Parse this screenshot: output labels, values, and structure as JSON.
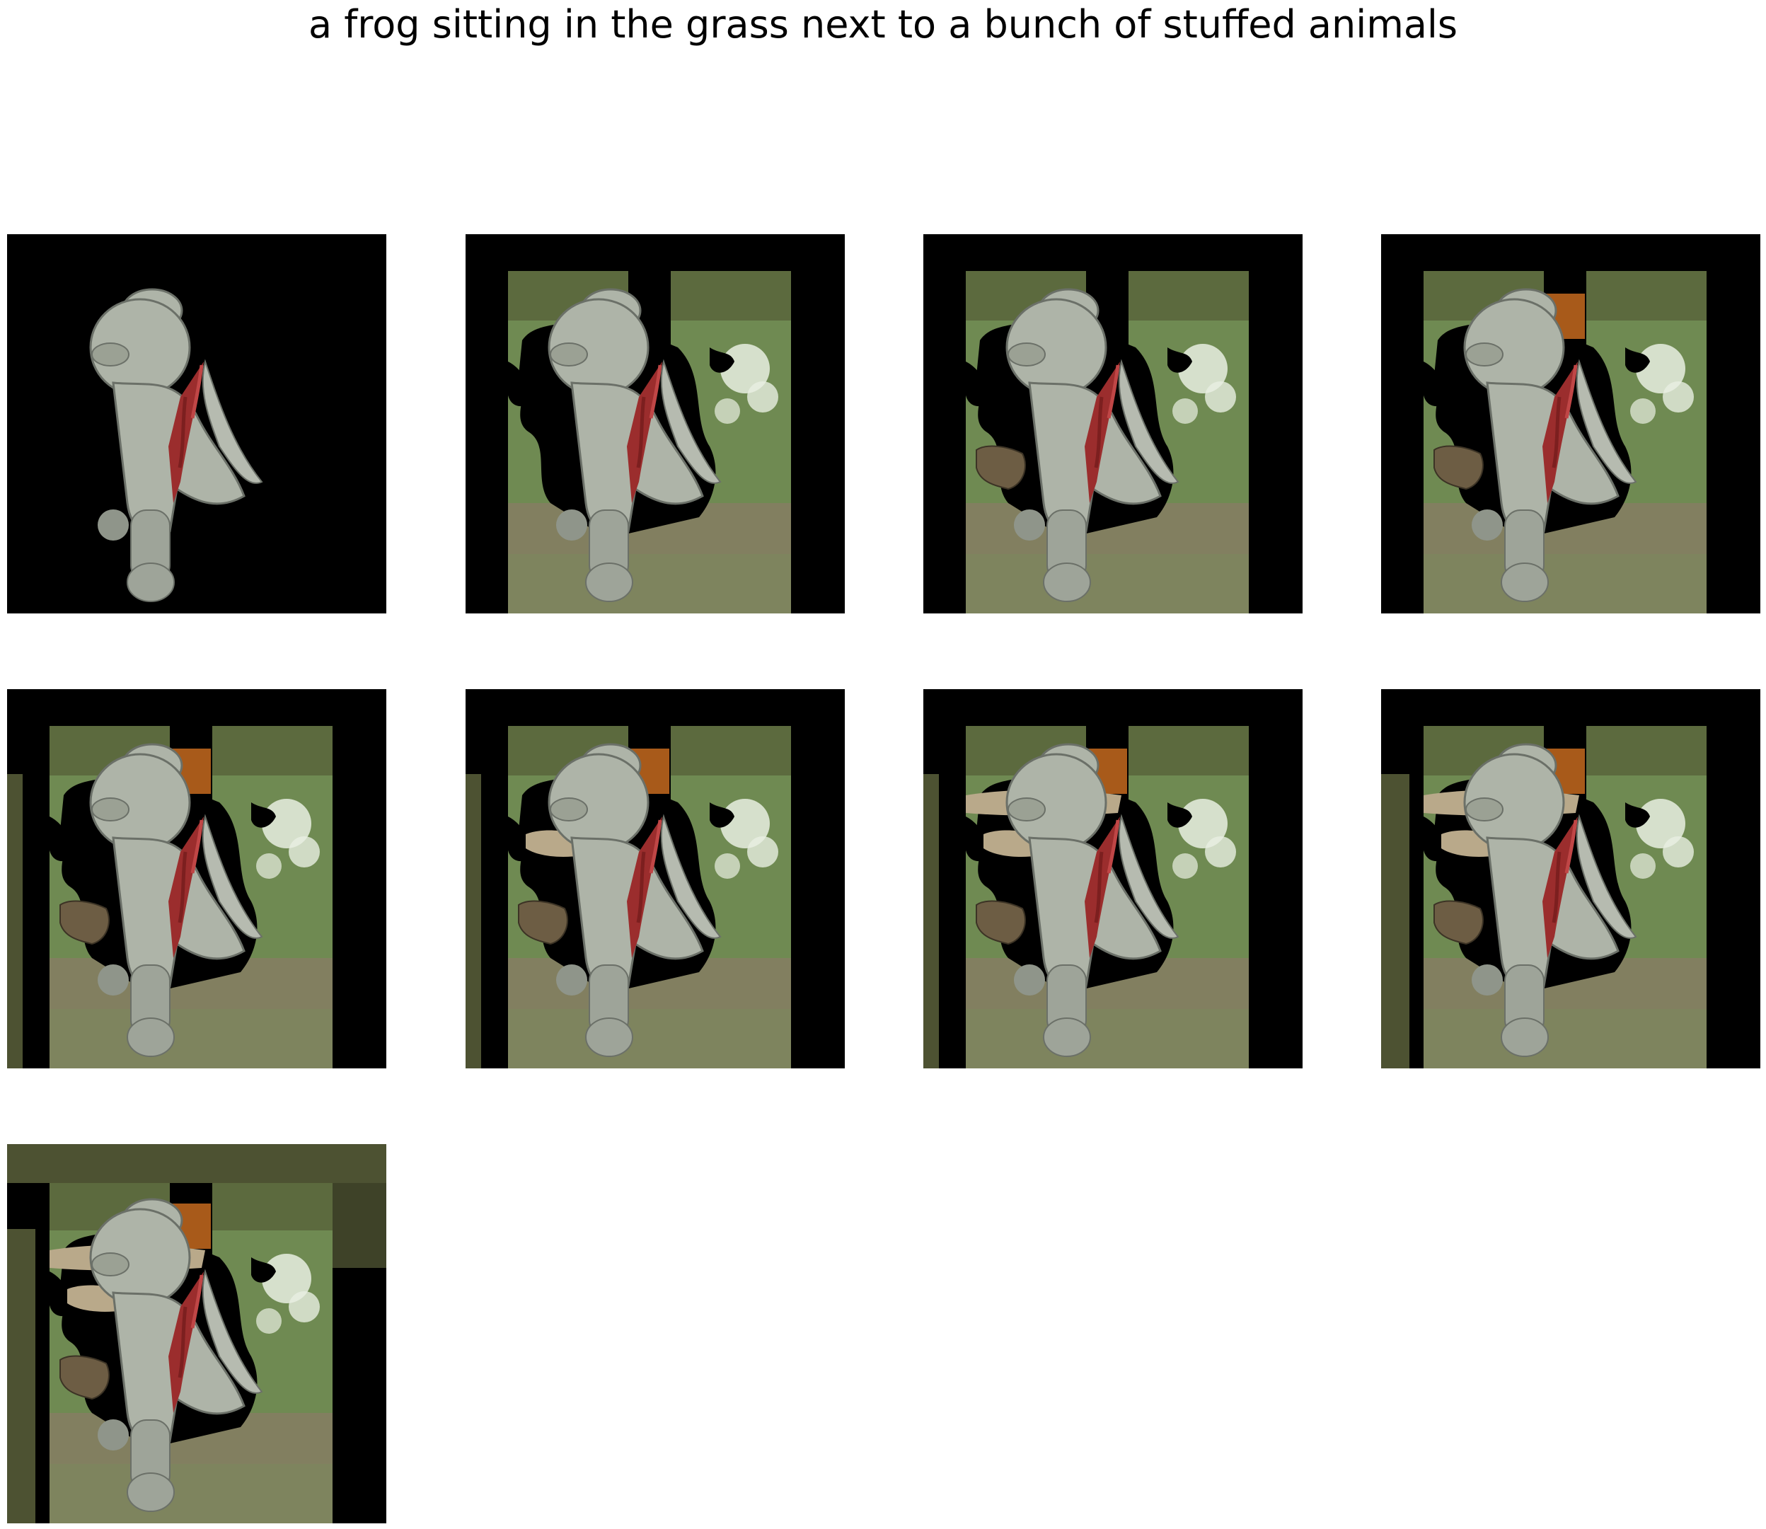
{
  "title": "a frog sitting in the grass next to a bunch of stuffed animals",
  "colors": {
    "background": "#ffffff",
    "mask": "#000000",
    "grass": "#6f8a52",
    "soil": "#8a7a66",
    "plush": "#aeb4a8",
    "ribbon": "#9b2d2d",
    "bark": "#a85a1a",
    "moss": "#4d5232",
    "flowers": "#e9efe2"
  },
  "panels": [
    {
      "id": 1,
      "layers": []
    },
    {
      "id": 2,
      "layers": [
        "scene"
      ]
    },
    {
      "id": 3,
      "layers": [
        "scene",
        "rock"
      ]
    },
    {
      "id": 4,
      "layers": [
        "scene",
        "rock",
        "trunk"
      ]
    },
    {
      "id": 5,
      "layers": [
        "scene",
        "rock",
        "trunk",
        "left-strip"
      ]
    },
    {
      "id": 6,
      "layers": [
        "scene",
        "rock",
        "trunk",
        "left-strip",
        "patch"
      ]
    },
    {
      "id": 7,
      "layers": [
        "scene",
        "rock",
        "trunk",
        "left-strip",
        "patch",
        "patch-wide"
      ]
    },
    {
      "id": 8,
      "layers": [
        "scene",
        "rock",
        "trunk",
        "left-strip",
        "patch",
        "patch-wide",
        "left-strip-2"
      ]
    },
    {
      "id": 9,
      "layers": [
        "scene",
        "rock",
        "trunk",
        "left-strip",
        "patch",
        "patch-wide",
        "left-strip-2",
        "top-band"
      ]
    }
  ]
}
